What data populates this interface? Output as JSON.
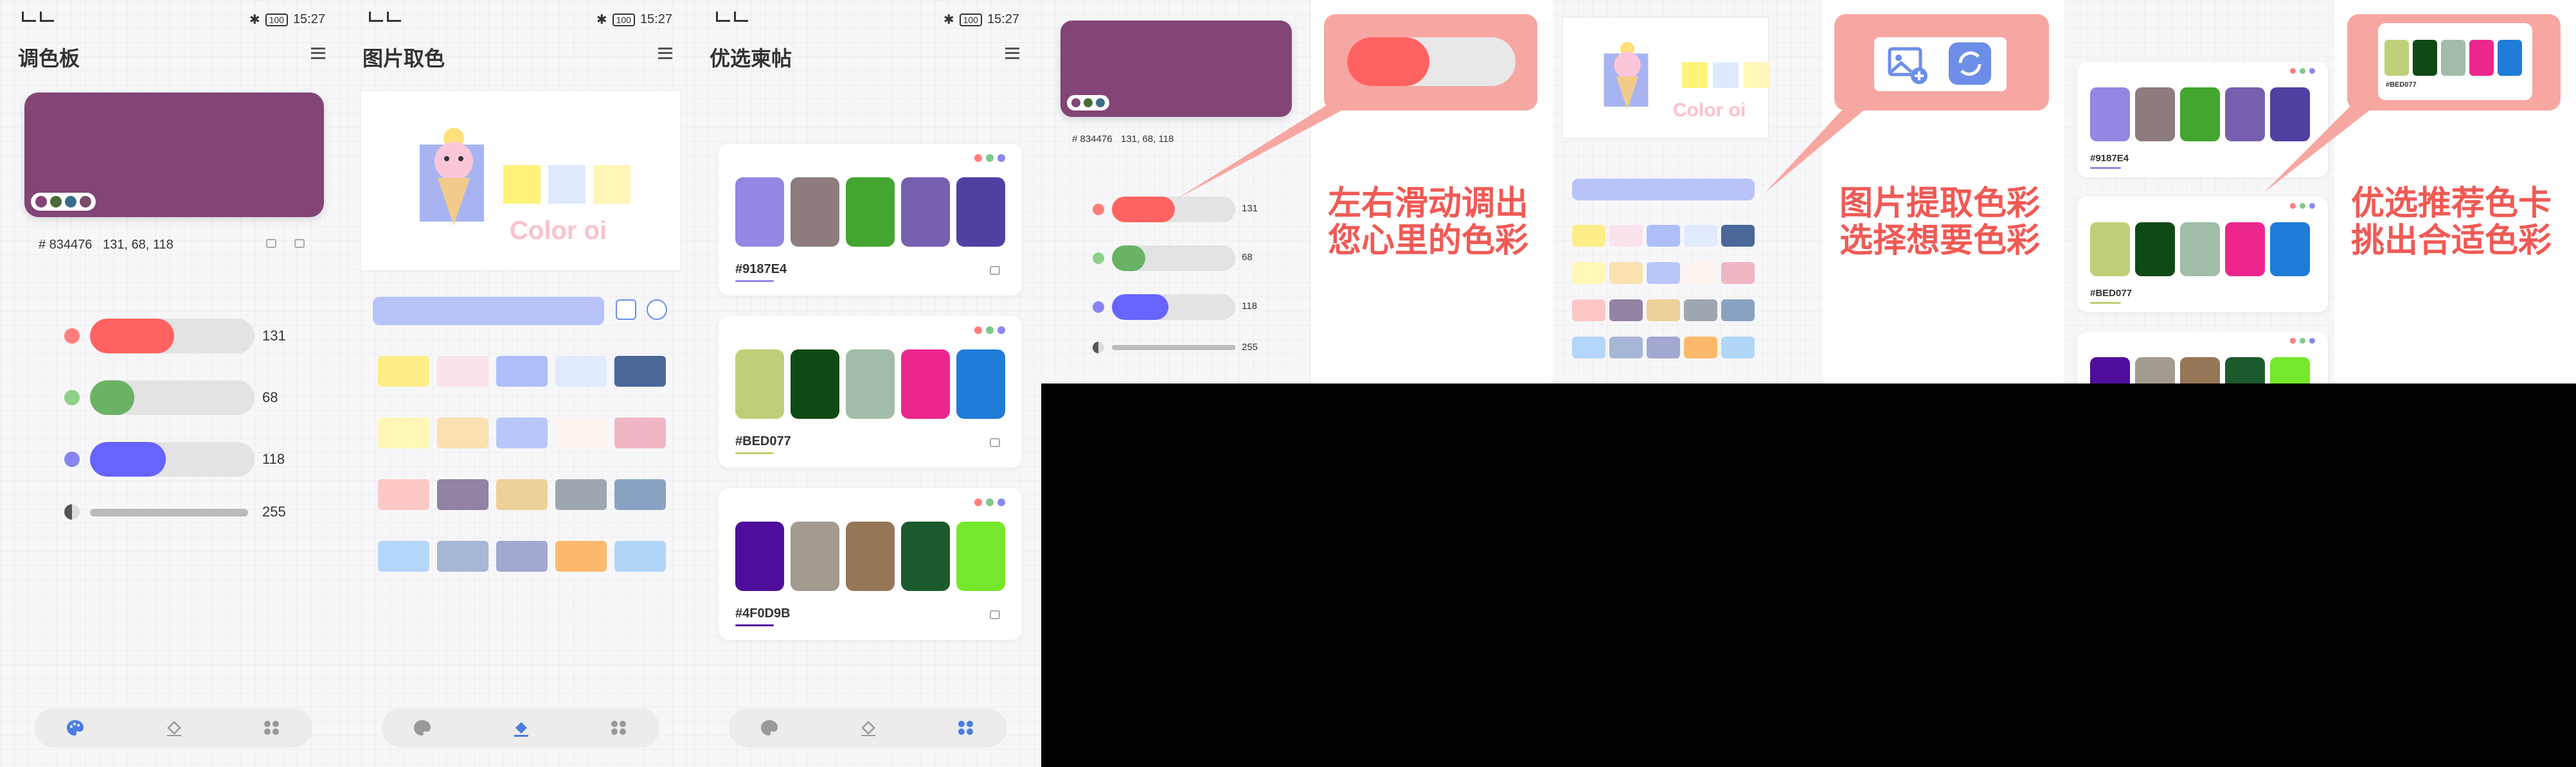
{
  "status_bar": {
    "time": "15:27",
    "battery": "100"
  },
  "palette_screen": {
    "title": "调色板",
    "color_hex": "# 834476",
    "color_rgb": "131, 68, 118",
    "main_color": "#834476",
    "mini_dots": [
      "#834476",
      "#4b6a38",
      "#3a6d8a",
      "#7c4b6b"
    ],
    "sliders": [
      {
        "name": "red",
        "value": "131",
        "fraction": 0.51,
        "color": "#ff6361",
        "dot": "#ff7e7b"
      },
      {
        "name": "green",
        "value": "68",
        "fraction": 0.27,
        "color": "#6ab364",
        "dot": "#8fd08a"
      },
      {
        "name": "blue",
        "value": "118",
        "fraction": 0.46,
        "color": "#6764ff",
        "dot": "#8785f2"
      }
    ],
    "alpha_value": "255"
  },
  "image_screen": {
    "title": "图片取色",
    "logo_text": "Color oi",
    "palette": [
      "#fff27a",
      "#dfeaff",
      "#fff6b8"
    ],
    "tiles": [
      [
        "#fdee8a",
        "#fbe3ee",
        "#aebef8",
        "#e2eaff",
        "#4a6898"
      ],
      [
        "#fff7b7",
        "#fbe0b0",
        "#b9c6f8",
        "#fdf4f0",
        "#f0b6c4"
      ],
      [
        "#fcc8c6",
        "#9282a4",
        "#ecd19a",
        "#9ea6b0",
        "#8aa2c2"
      ],
      [
        "#b4d6fa",
        "#a6b6d6",
        "#a2a8d0",
        "#fdba6c",
        "#b1d6f8"
      ]
    ]
  },
  "favorites_screen": {
    "title": "优选柬帖",
    "cards": [
      {
        "hex": "#9187E4",
        "colors": [
          "#9187e4",
          "#8e7b7d",
          "#42a630",
          "#775fb0",
          "#5140a2"
        ],
        "underline": "#9187e4"
      },
      {
        "hex": "#BED077",
        "colors": [
          "#bed077",
          "#0f4a16",
          "#a1bca9",
          "#ec268e",
          "#1f7cd8"
        ],
        "underline": "#bed077"
      },
      {
        "hex": "#4F0D9B",
        "colors": [
          "#4f0d9b",
          "#a39a90",
          "#957657",
          "#1c5a2e",
          "#76e82b"
        ],
        "underline": "#4f0d9b"
      }
    ],
    "dots": [
      "#ff7e7b",
      "#7ec98a",
      "#8a87f0"
    ]
  },
  "promo": {
    "slide1": {
      "line1": "左右滑动调出",
      "line2": "您心里的色彩"
    },
    "slide2": {
      "line1": "图片提取色彩",
      "line2": "选择想要色彩"
    },
    "slide3": {
      "line1": "优选推荐色卡",
      "line2": "挑出合适色彩"
    },
    "slide1_values": [
      "131",
      "68",
      "118",
      "255"
    ],
    "slide1_hex": "# 834476",
    "slide1_rgb": "131, 68, 118",
    "slide3_hex1": "#9187E4",
    "slide3_hex2": "#BED077",
    "slide3_bubble_hex": "#BED077"
  }
}
